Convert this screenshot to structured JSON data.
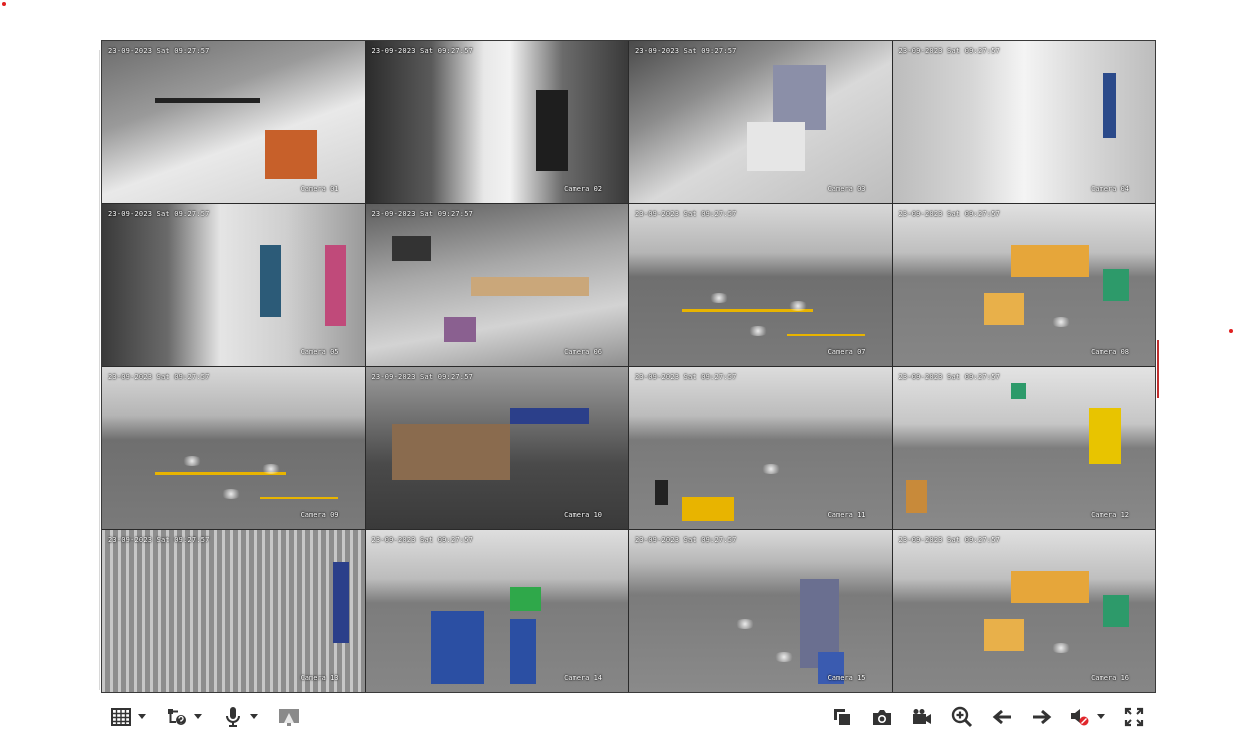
{
  "cameras": [
    {
      "name": "Camera 01",
      "time": "23-09-2023 Sat 09:27:57",
      "selected": true,
      "scene": "stairs"
    },
    {
      "name": "Camera 02",
      "time": "23-09-2023 Sat 09:27:57",
      "selected": false,
      "scene": "corridor"
    },
    {
      "name": "Camera 03",
      "time": "23-09-2023 Sat 09:27:57",
      "selected": false,
      "scene": "lobby"
    },
    {
      "name": "Camera 04",
      "time": "23-09-2023 Sat 09:27:57",
      "selected": false,
      "scene": "hallway"
    },
    {
      "name": "Camera 05",
      "time": "23-09-2023 Sat 09:27:57",
      "selected": false,
      "scene": "doorway"
    },
    {
      "name": "Camera 06",
      "time": "23-09-2023 Sat 09:27:57",
      "selected": false,
      "scene": "office"
    },
    {
      "name": "Camera 07",
      "time": "23-09-2023 Sat 09:27:57",
      "selected": false,
      "scene": "warehouse"
    },
    {
      "name": "Camera 08",
      "time": "23-09-2023 Sat 09:27:57",
      "selected": false,
      "scene": "warehouse-boxes"
    },
    {
      "name": "Camera 09",
      "time": "23-09-2023 Sat 09:27:57",
      "selected": false,
      "scene": "warehouse"
    },
    {
      "name": "Camera 10",
      "time": "23-09-2023 Sat 09:27:57",
      "selected": false,
      "scene": "storage"
    },
    {
      "name": "Camera 11",
      "time": "23-09-2023 Sat 09:27:57",
      "selected": false,
      "scene": "warehouse-dock"
    },
    {
      "name": "Camera 12",
      "time": "23-09-2023 Sat 09:27:57",
      "selected": false,
      "scene": "warehouse-door"
    },
    {
      "name": "Camera 13",
      "time": "23-09-2023 Sat 09:27:57",
      "selected": false,
      "scene": "racks"
    },
    {
      "name": "Camera 14",
      "time": "23-09-2023 Sat 09:27:57",
      "selected": false,
      "scene": "crates"
    },
    {
      "name": "Camera 15",
      "time": "23-09-2023 Sat 09:27:57",
      "selected": false,
      "scene": "floor"
    },
    {
      "name": "Camera 16",
      "time": "23-09-2023 Sat 09:27:57",
      "selected": false,
      "scene": "warehouse-boxes"
    }
  ],
  "toolbar": {
    "left": [
      "window-layout-icon",
      "stream-type-icon",
      "microphone-icon",
      "pip-icon"
    ],
    "right": [
      "window-switch-icon",
      "capture-icon",
      "record-icon",
      "digital-zoom-icon",
      "previous-page-icon",
      "next-page-icon",
      "audio-muted-icon",
      "fullscreen-icon"
    ]
  },
  "colors": {
    "selected_border": "#e8b400",
    "icon": "#333333",
    "mute_badge": "#e0262b",
    "floor_yellow": "#e8b400"
  }
}
